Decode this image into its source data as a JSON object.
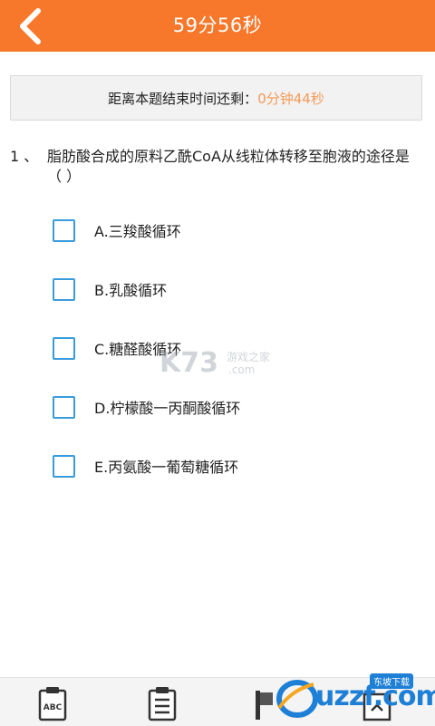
{
  "header": {
    "title": "59分56秒"
  },
  "timer": {
    "label": "距离本题结束时间还剩：",
    "value": "0分钟44秒"
  },
  "question": {
    "number": "1 、",
    "text": "脂肪酸合成的原料乙酰CoA从线粒体转移至胞液的途径是（ ）",
    "options": [
      {
        "label": "A.三羧酸循环",
        "checked": false
      },
      {
        "label": "B.乳酸循环",
        "checked": false
      },
      {
        "label": "C.糖醛酸循环",
        "checked": false
      },
      {
        "label": "D.柠檬酸一丙酮酸循环",
        "checked": false
      },
      {
        "label": "E.丙氨酸一葡萄糖循环",
        "checked": false
      }
    ]
  },
  "watermark": {
    "text": "游戏之家",
    "sub": ".com"
  },
  "toolbar": {
    "answer_sheet_icon_text": "ABC"
  },
  "logo": {
    "text": "uzzf.com",
    "tag": "东坡下载"
  },
  "colors": {
    "accent": "#f7782b",
    "checkbox": "#3a9bdc",
    "timer_value": "#f49a57"
  }
}
